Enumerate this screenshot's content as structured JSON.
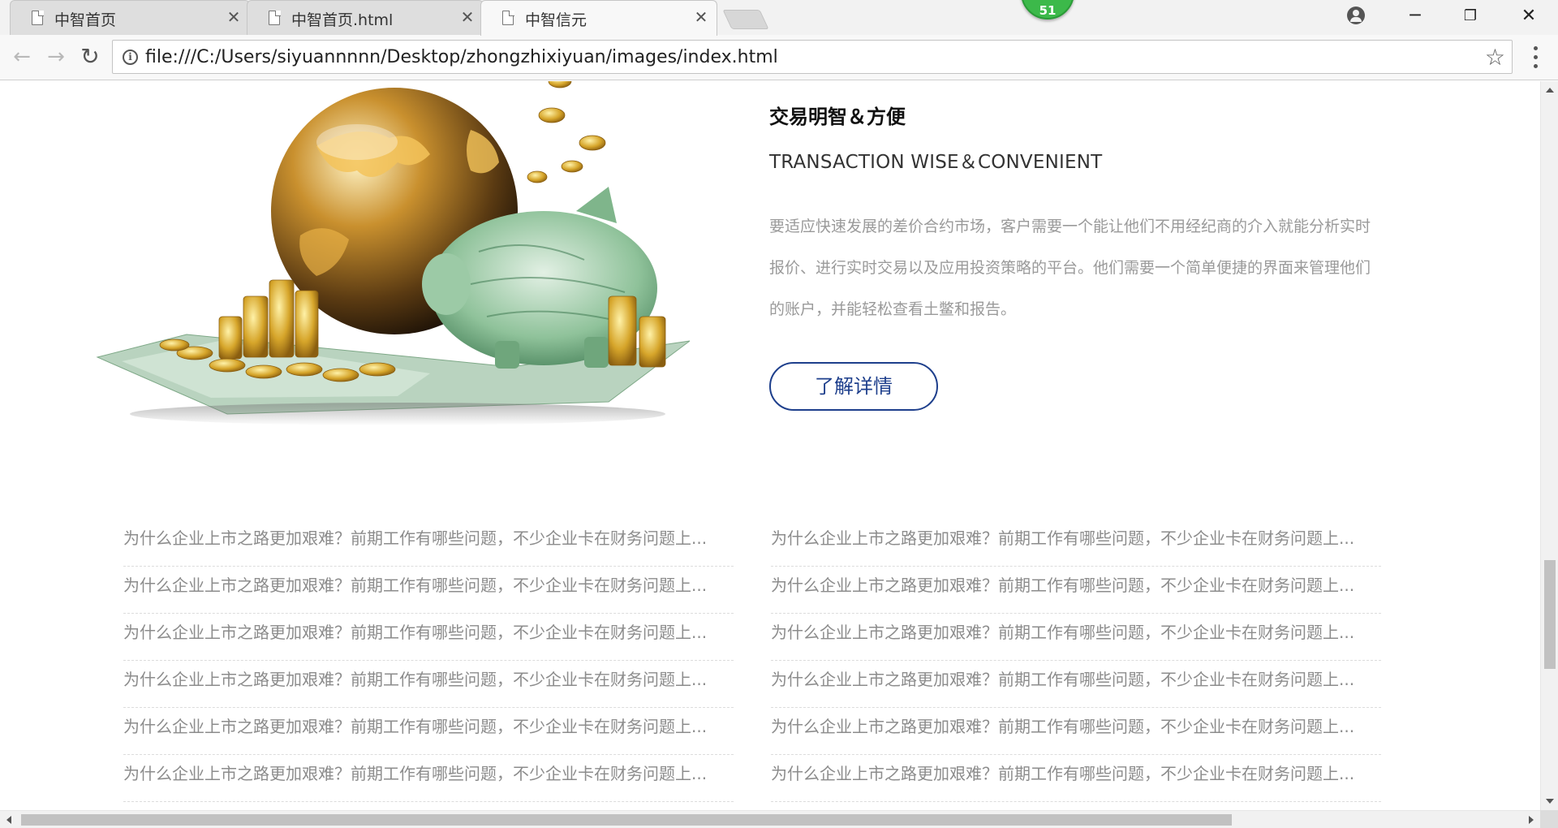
{
  "browser": {
    "tabs": [
      {
        "title": "中智首页",
        "active": false
      },
      {
        "title": "中智首页.html",
        "active": false
      },
      {
        "title": "中智信元",
        "active": true
      }
    ],
    "extension_badge": "51",
    "url": "file:///C:/Users/siyuannnnn/Desktop/zhongzhixiyuan/images/index.html"
  },
  "feature": {
    "title_zh": "交易明智＆方便",
    "title_en": "TRANSACTION WISE＆CONVENIENT",
    "description": "要适应快速发展的差价合约市场，客户需要一个能让他们不用经纪商的介入就能分析实时报价、进行实时交易以及应用投资策略的平台。他们需要一个简单便捷的界面来管理他们的账户，并能轻松查看土鳖和报告。",
    "button_label": "了解详情"
  },
  "news": {
    "left": [
      "为什么企业上市之路更加艰难？前期工作有哪些问题，不少企业卡在财务问题上...",
      "为什么企业上市之路更加艰难？前期工作有哪些问题，不少企业卡在财务问题上...",
      "为什么企业上市之路更加艰难？前期工作有哪些问题，不少企业卡在财务问题上...",
      "为什么企业上市之路更加艰难？前期工作有哪些问题，不少企业卡在财务问题上...",
      "为什么企业上市之路更加艰难？前期工作有哪些问题，不少企业卡在财务问题上...",
      "为什么企业上市之路更加艰难？前期工作有哪些问题，不少企业卡在财务问题上..."
    ],
    "right": [
      "为什么企业上市之路更加艰难？前期工作有哪些问题，不少企业卡在财务问题上...",
      "为什么企业上市之路更加艰难？前期工作有哪些问题，不少企业卡在财务问题上...",
      "为什么企业上市之路更加艰难？前期工作有哪些问题，不少企业卡在财务问题上...",
      "为什么企业上市之路更加艰难？前期工作有哪些问题，不少企业卡在财务问题上...",
      "为什么企业上市之路更加艰难？前期工作有哪些问题，不少企业卡在财务问题上...",
      "为什么企业上市之路更加艰难？前期工作有哪些问题，不少企业卡在财务问题上..."
    ]
  },
  "colors": {
    "button_accent": "#1e3f8c",
    "body_text": "#9a9a9a",
    "badge_green": "#3cb94a"
  },
  "icons": [
    "page-icon",
    "close-icon",
    "back-icon",
    "forward-icon",
    "reload-icon",
    "info-icon",
    "star-icon",
    "menu-icon",
    "profile-icon",
    "minimize-icon",
    "restore-icon",
    "window-close-icon"
  ]
}
